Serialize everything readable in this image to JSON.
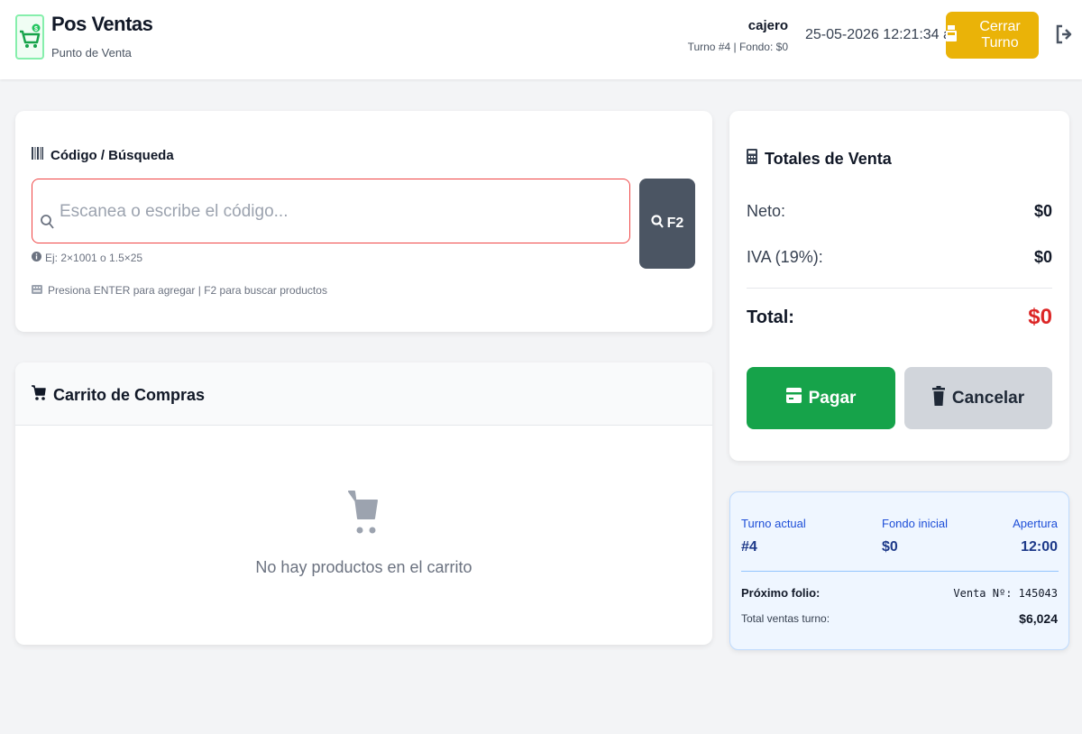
{
  "header": {
    "app_title": "Pos Ventas",
    "app_subtitle": "Punto de Venta",
    "user_name": "cajero",
    "user_meta": "Turno #4 | Fondo: $0",
    "datetime": "25-05-2026 12:21:34 a. m.",
    "close_shift_label": "Cerrar Turno",
    "logo_icon": "cart-icon",
    "logout_icon": "logout-icon"
  },
  "search": {
    "section_title": "Código / Búsqueda",
    "placeholder": "Escanea o escribe el código...",
    "value": "",
    "f2_label": "F2",
    "hint_example": "Ej: 2×1001 o 1.5×25",
    "hint_keys": "Presiona ENTER para agregar | F2 para buscar productos"
  },
  "cart": {
    "title": "Carrito de Compras",
    "empty_message": "No hay productos en el carrito"
  },
  "totals": {
    "title": "Totales de Venta",
    "neto_label": "Neto:",
    "neto_value": "$0",
    "iva_label": "IVA (19%):",
    "iva_value": "$0",
    "total_label": "Total:",
    "total_value": "$0",
    "pay_label": "Pagar",
    "cancel_label": "Cancelar"
  },
  "shift": {
    "current_label": "Turno actual",
    "current_value": "#4",
    "fund_label": "Fondo inicial",
    "fund_value": "$0",
    "opening_label": "Apertura",
    "opening_value": "12:00",
    "next_folio_label": "Próximo folio:",
    "next_folio_value": "Venta Nº: 145043",
    "total_sales_label": "Total ventas turno:",
    "total_sales_value": "$6,024"
  },
  "colors": {
    "primary_green": "#16a34a",
    "warning_yellow": "#eab308",
    "danger_red": "#dc2626",
    "info_blue": "#1d4ed8"
  }
}
